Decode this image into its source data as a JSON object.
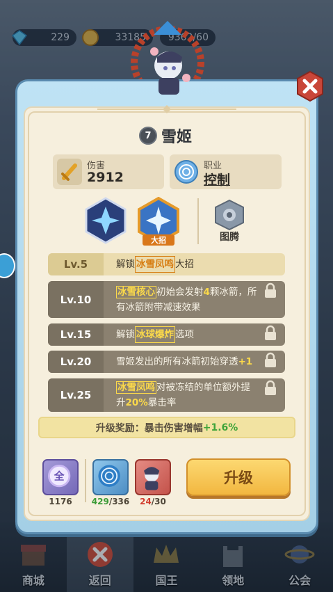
{
  "currency": {
    "gems": "229",
    "coins": "33185",
    "energy": "9362/60"
  },
  "hero": {
    "level": "7",
    "name": "雪姬"
  },
  "stats": {
    "damage_label": "伤害",
    "damage_value": "2912",
    "job_label": "职业",
    "job_value": "控制"
  },
  "skills": {
    "ult_tag": "大招",
    "totem_label": "图腾"
  },
  "levels": [
    {
      "lv": "Lv.5",
      "pre": "解锁",
      "hl": "冰雪凤鸣",
      "post": "大招",
      "active": true
    },
    {
      "lv": "Lv.10",
      "hl": "冰雪核心",
      "a": "初始会发射",
      "num": "4",
      "b": "颗冰箭，所有冰箭附带减速效果"
    },
    {
      "lv": "Lv.15",
      "pre": "解锁",
      "hl": "冰球爆炸",
      "post": "选项"
    },
    {
      "lv": "Lv.20",
      "a": "雪姬发出的所有冰箭初始穿透",
      "num": "+1"
    },
    {
      "lv": "Lv.25",
      "hl": "冰雪凤鸣",
      "a": "对被冻结的单位额外提升",
      "num": "20%",
      "b": "暴击率"
    }
  ],
  "reward": {
    "label": "升级奖励：暴击伤害增幅",
    "value": "+1.6%"
  },
  "items": [
    {
      "glyph": "全",
      "count": "1176"
    },
    {
      "count_have": "429",
      "count_need": "/336"
    },
    {
      "count_have": "24",
      "count_need": "/30"
    }
  ],
  "upgrade_label": "升级",
  "nav": [
    "商城",
    "返回",
    "国王",
    "领地",
    "公会"
  ],
  "colors": {
    "accent": "#f2b740",
    "highlight": "#fbd94a",
    "green": "#3fa43a"
  }
}
